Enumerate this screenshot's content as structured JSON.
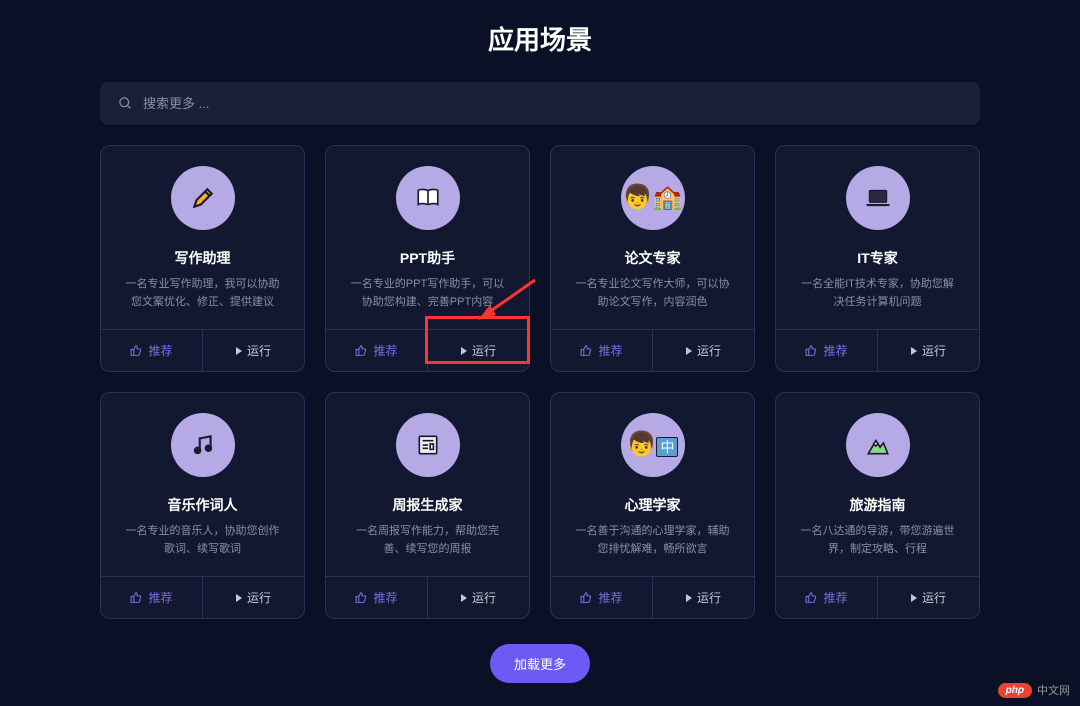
{
  "title": "应用场景",
  "search": {
    "placeholder": "搜索更多 ..."
  },
  "buttons": {
    "recommend": "推荐",
    "run": "运行",
    "loadMore": "加载更多"
  },
  "cards": [
    {
      "icon": "pencil",
      "title": "写作助理",
      "desc": "一名专业写作助理，我可以协助您文案优化、修正、提供建议"
    },
    {
      "icon": "book",
      "title": "PPT助手",
      "desc": "一名专业的PPT写作助手，可以协助您构建、完善PPT内容"
    },
    {
      "icon": "thesis",
      "title": "论文专家",
      "desc": "一名专业论文写作大师，可以协助论文写作，内容润色"
    },
    {
      "icon": "laptop",
      "title": "IT专家",
      "desc": "一名全能IT技术专家，协助您解决任务计算机问题"
    },
    {
      "icon": "music",
      "title": "音乐作词人",
      "desc": "一名专业的音乐人，协助您创作歌词、续写歌词"
    },
    {
      "icon": "news",
      "title": "周报生成家",
      "desc": "一名周报写作能力，帮助您完善、续写您的周报"
    },
    {
      "icon": "psych",
      "title": "心理学家",
      "desc": "一名善于沟通的心理学家，辅助您排忧解难，畅所欲言"
    },
    {
      "icon": "mountain",
      "title": "旅游指南",
      "desc": "一名八达通的导游，带您游遍世界，制定攻略、行程"
    }
  ],
  "watermark": {
    "badge": "php",
    "text": "中文网"
  }
}
